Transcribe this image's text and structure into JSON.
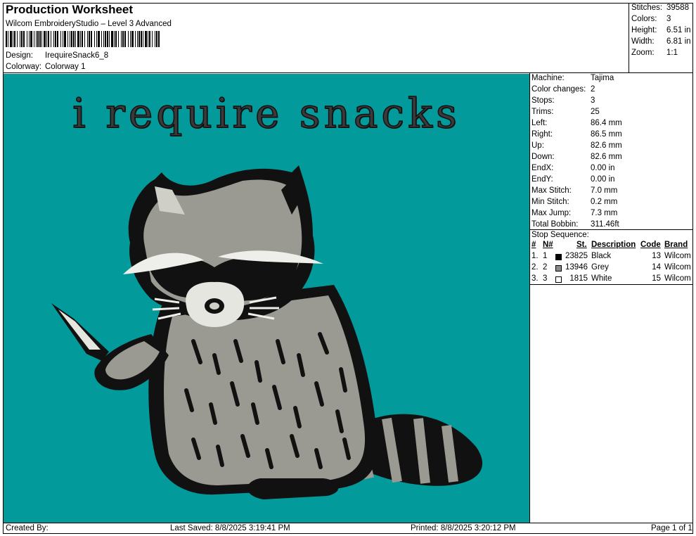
{
  "header": {
    "title": "Production Worksheet",
    "software": "Wilcom EmbroideryStudio – Level 3 Advanced",
    "design_label": "Design:",
    "design_value": "IrequireSnack6_8",
    "colorway_label": "Colorway:",
    "colorway_value": "Colorway 1"
  },
  "stats": [
    {
      "label": "Stitches:",
      "value": "39588"
    },
    {
      "label": "Colors:",
      "value": "3"
    },
    {
      "label": "Height:",
      "value": "6.51 in"
    },
    {
      "label": "Width:",
      "value": "6.81 in"
    },
    {
      "label": "Zoom:",
      "value": "1:1"
    }
  ],
  "design": {
    "text": "i require snacks",
    "background_color": "#039a9c"
  },
  "machine_info": [
    {
      "label": "Machine:",
      "value": "Tajima"
    },
    {
      "label": "Color changes:",
      "value": "2"
    },
    {
      "label": "Stops:",
      "value": "3"
    },
    {
      "label": "Trims:",
      "value": "25"
    },
    {
      "label": "Left:",
      "value": "86.4 mm"
    },
    {
      "label": "Right:",
      "value": "86.5 mm"
    },
    {
      "label": "Up:",
      "value": "82.6 mm"
    },
    {
      "label": "Down:",
      "value": "82.6 mm"
    },
    {
      "label": "EndX:",
      "value": "0.00 in"
    },
    {
      "label": "EndY:",
      "value": "0.00 in"
    },
    {
      "label": "Max Stitch:",
      "value": "7.0 mm"
    },
    {
      "label": "Min Stitch:",
      "value": "0.2 mm"
    },
    {
      "label": "Max Jump:",
      "value": "7.3 mm"
    },
    {
      "label": "Total Bobbin:",
      "value": "311.46ft"
    }
  ],
  "stop_sequence": {
    "title": "Stop Sequence:",
    "headers": {
      "index": "#",
      "needle": "N#",
      "stitches": "St.",
      "description": "Description",
      "code": "Code",
      "brand": "Brand"
    },
    "rows": [
      {
        "index": "1.",
        "needle": "1",
        "color": "#000000",
        "stitches": "23825",
        "description": "Black",
        "code": "13",
        "brand": "Wilcom"
      },
      {
        "index": "2.",
        "needle": "2",
        "color": "#8a8a8a",
        "stitches": "13946",
        "description": "Grey",
        "code": "14",
        "brand": "Wilcom"
      },
      {
        "index": "3.",
        "needle": "3",
        "color": "#ffffff",
        "stitches": "1815",
        "description": "White",
        "code": "15",
        "brand": "Wilcom"
      }
    ]
  },
  "footer": {
    "created_by": "Created By:",
    "last_saved": "Last Saved: 8/8/2025 3:19:41 PM",
    "printed": "Printed: 8/8/2025 3:20:12 PM",
    "page": "Page 1 of 1"
  }
}
